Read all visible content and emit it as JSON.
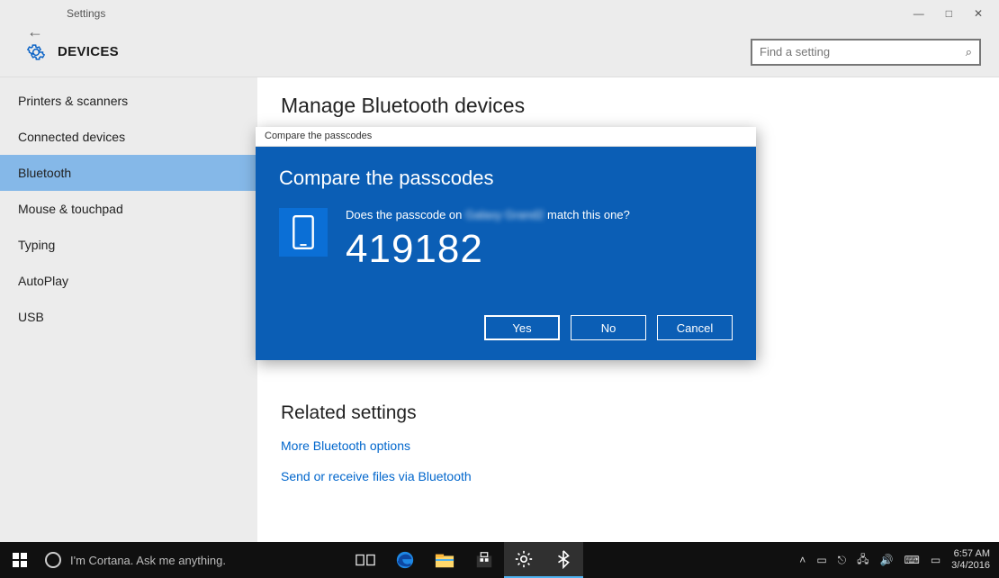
{
  "titlebar": {
    "app_name": "Settings"
  },
  "header": {
    "section": "DEVICES",
    "search_placeholder": "Find a setting"
  },
  "sidebar": {
    "items": [
      {
        "label": "Printers & scanners",
        "selected": false
      },
      {
        "label": "Connected devices",
        "selected": false
      },
      {
        "label": "Bluetooth",
        "selected": true
      },
      {
        "label": "Mouse & touchpad",
        "selected": false
      },
      {
        "label": "Typing",
        "selected": false
      },
      {
        "label": "AutoPlay",
        "selected": false
      },
      {
        "label": "USB",
        "selected": false
      }
    ]
  },
  "main": {
    "heading": "Manage Bluetooth devices",
    "related_heading": "Related settings",
    "links": [
      "More Bluetooth options",
      "Send or receive files via Bluetooth"
    ]
  },
  "dialog": {
    "window_title": "Compare the passcodes",
    "heading": "Compare the passcodes",
    "prompt_prefix": "Does the passcode on ",
    "device_name": "Galaxy Grand2",
    "prompt_suffix": " match this one?",
    "passcode": "419182",
    "buttons": {
      "yes": "Yes",
      "no": "No",
      "cancel": "Cancel"
    }
  },
  "taskbar": {
    "cortana_placeholder": "I'm Cortana. Ask me anything.",
    "clock_time": "6:57 AM",
    "clock_date": "3/4/2016"
  }
}
